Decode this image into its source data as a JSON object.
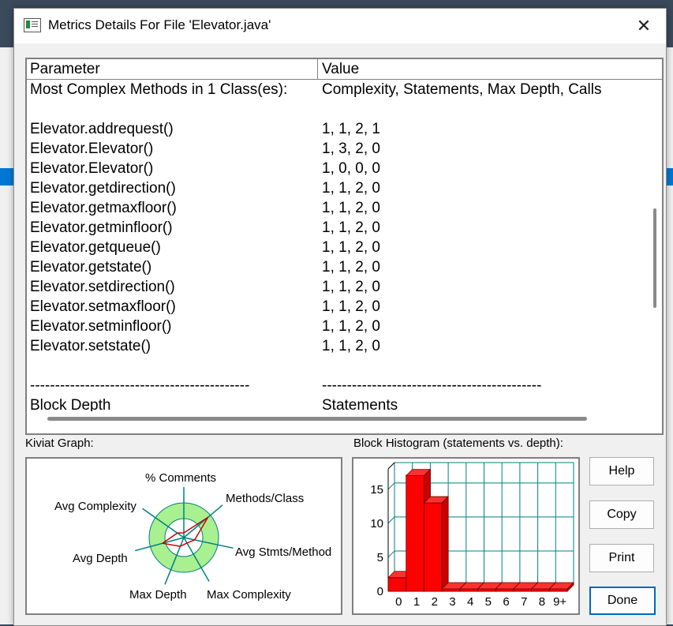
{
  "dialog": {
    "title": "Metrics Details For File 'Elevator.java'",
    "close_glyph": "✕"
  },
  "table": {
    "headers": [
      "Parameter",
      "Value"
    ],
    "rows": [
      {
        "param": "Most Complex Methods in 1 Class(es):",
        "value": "Complexity, Statements, Max Depth, Calls"
      },
      {
        "param": "",
        "value": ""
      },
      {
        "param": "Elevator.addrequest()",
        "value": "1, 1, 2, 1"
      },
      {
        "param": "Elevator.Elevator()",
        "value": "1, 3, 2, 0"
      },
      {
        "param": "Elevator.Elevator()",
        "value": "1, 0, 0, 0"
      },
      {
        "param": "Elevator.getdirection()",
        "value": "1, 1, 2, 0"
      },
      {
        "param": "Elevator.getmaxfloor()",
        "value": "1, 1, 2, 0"
      },
      {
        "param": "Elevator.getminfloor()",
        "value": "1, 1, 2, 0"
      },
      {
        "param": "Elevator.getqueue()",
        "value": "1, 1, 2, 0"
      },
      {
        "param": "Elevator.getstate()",
        "value": "1, 1, 2, 0"
      },
      {
        "param": "Elevator.setdirection()",
        "value": "1, 1, 2, 0"
      },
      {
        "param": "Elevator.setmaxfloor()",
        "value": "1, 1, 2, 0"
      },
      {
        "param": "Elevator.setminfloor()",
        "value": "1, 1, 2, 0"
      },
      {
        "param": "Elevator.setstate()",
        "value": "1, 1, 2, 0"
      },
      {
        "param": "",
        "value": ""
      },
      {
        "param": "--------------------------------------------",
        "value": "--------------------------------------------"
      },
      {
        "param": "Block Depth",
        "value": "Statements"
      }
    ]
  },
  "kiviat": {
    "label": "Kiviat Graph:",
    "axes": [
      "% Comments",
      "Methods/Class",
      "Avg Stmts/Method",
      "Max Complexity",
      "Max Depth",
      "Avg Depth",
      "Avg Complexity"
    ],
    "ring_color": "#a8f090",
    "inner_color": "#ffffff",
    "axis_color": "#008080",
    "value_color": "#cc0000"
  },
  "histogram": {
    "label": "Block Histogram (statements vs. depth):",
    "bar_color": "#ff0000",
    "grid_color": "#008080"
  },
  "buttons": {
    "help": "Help",
    "copy": "Copy",
    "print": "Print",
    "done": "Done"
  },
  "chart_data": {
    "type": "bar",
    "categories": [
      "0",
      "1",
      "2",
      "3",
      "4",
      "5",
      "6",
      "7",
      "8",
      "9+"
    ],
    "values": [
      2,
      17,
      13,
      0,
      0,
      0,
      0,
      0,
      0,
      0
    ],
    "ylim": [
      0,
      18
    ],
    "yticks": [
      "0",
      "5",
      "10",
      "15"
    ],
    "grid": true
  }
}
